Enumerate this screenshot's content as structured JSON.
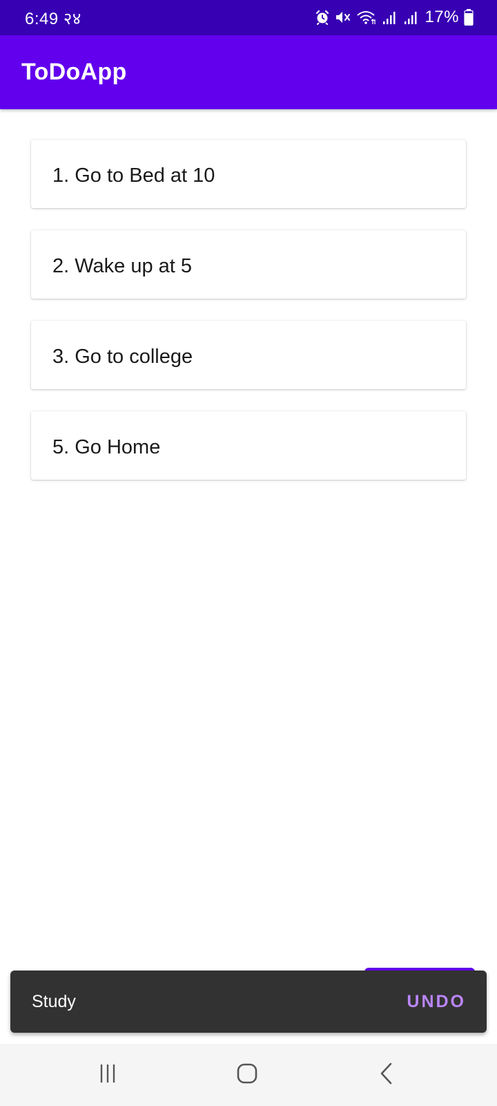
{
  "status_bar": {
    "time": "6:49 २४",
    "battery": "17%",
    "icons": [
      "alarm-icon",
      "mute-icon",
      "wifi-icon",
      "signal-icon",
      "signal-icon",
      "battery-icon"
    ]
  },
  "app_bar": {
    "title": "ToDoApp"
  },
  "todos": [
    {
      "text": "1. Go to Bed at 10"
    },
    {
      "text": "2. Wake up at 5"
    },
    {
      "text": "3. Go to college"
    },
    {
      "text": "5. Go Home"
    }
  ],
  "snackbar": {
    "message": "Study",
    "action": "UNDO"
  },
  "nav_bar": {
    "icons": [
      "recent-apps-icon",
      "home-icon",
      "back-icon"
    ]
  },
  "colors": {
    "status_bar": "#3700b3",
    "app_bar": "#6200ee",
    "snackbar_bg": "#323232",
    "snackbar_action": "#bb86fc",
    "nav_bar_bg": "#f5f5f5"
  }
}
